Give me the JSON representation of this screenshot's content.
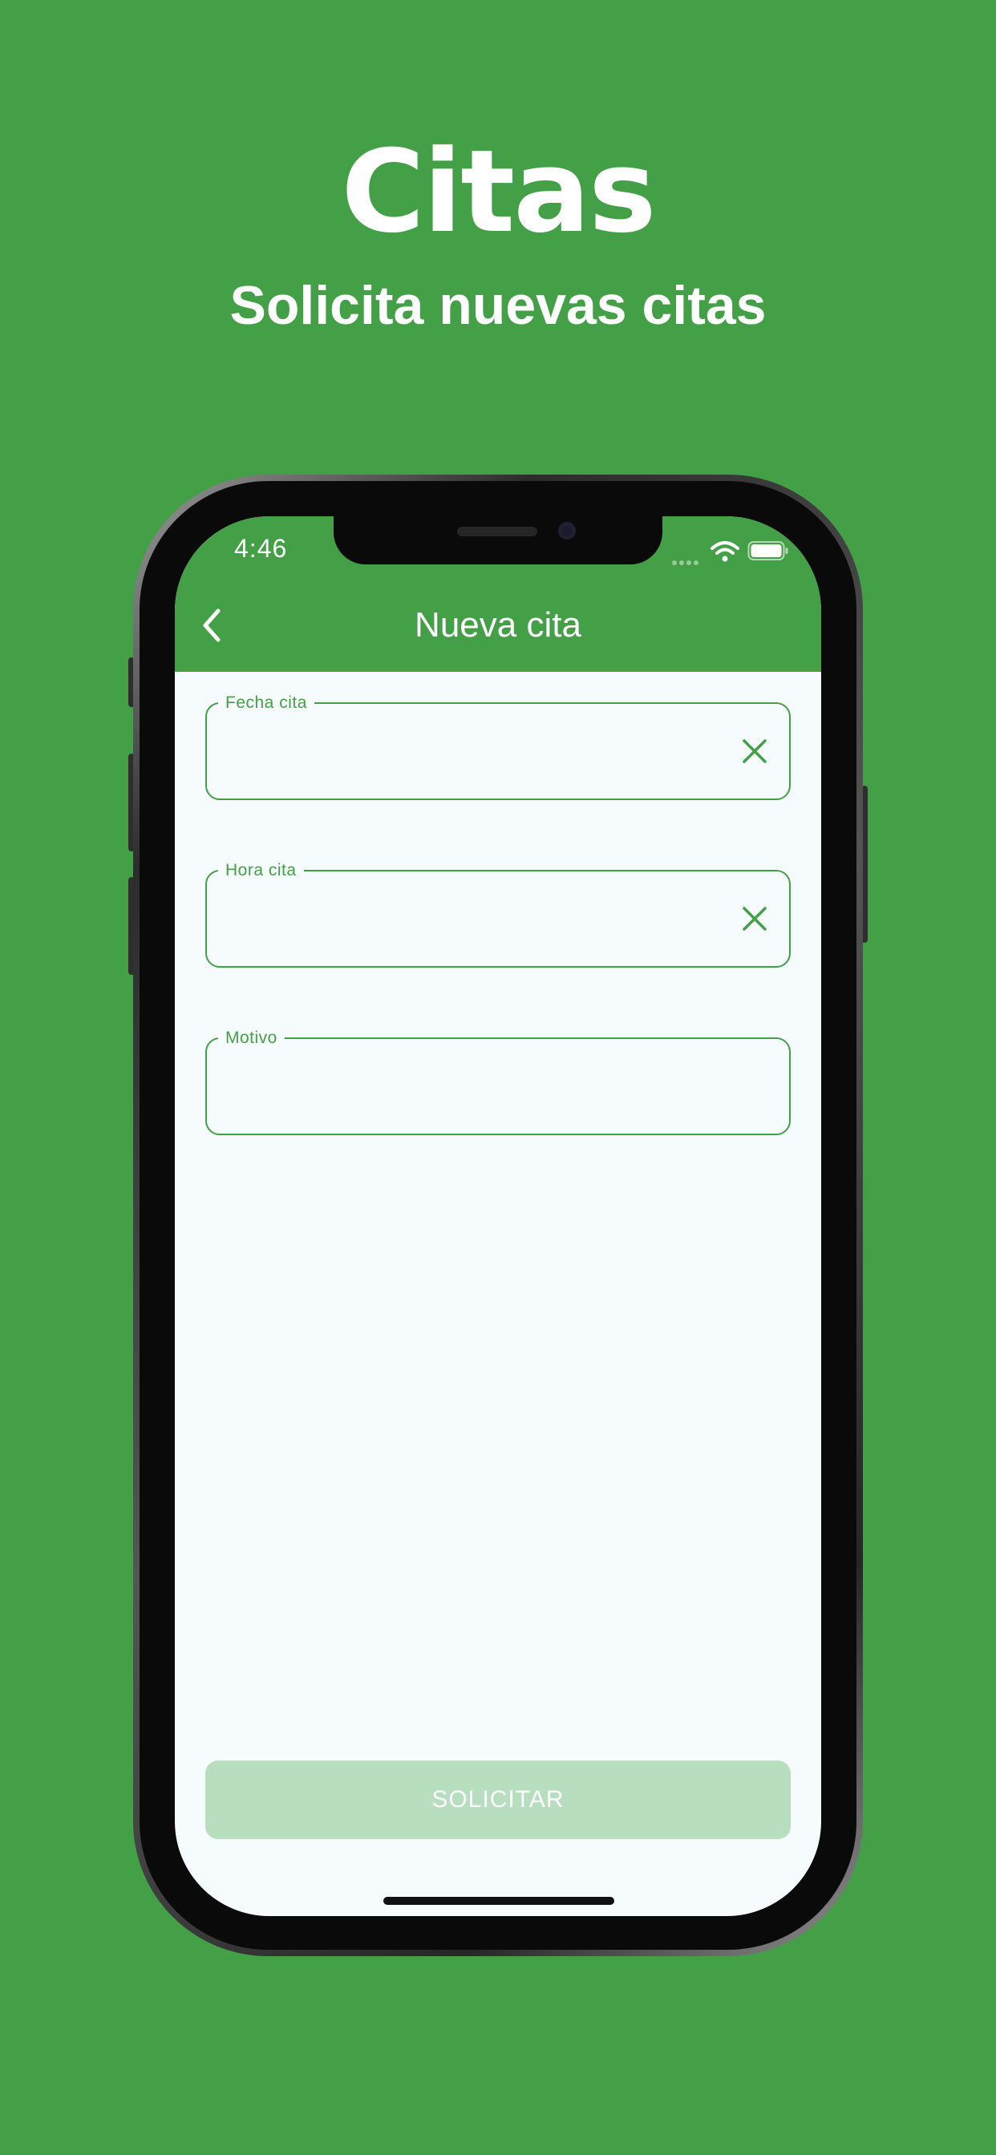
{
  "promo": {
    "title": "Citas",
    "subtitle": "Solicita nuevas citas"
  },
  "status_bar": {
    "time": "4:46",
    "icons": [
      "signal-dots-icon",
      "wifi-icon",
      "battery-icon"
    ]
  },
  "app_bar": {
    "title": "Nueva cita",
    "back_icon": "chevron-left-icon"
  },
  "form": {
    "fields": [
      {
        "label": "Fecha cita",
        "value": "",
        "has_clear": true
      },
      {
        "label": "Hora cita",
        "value": "",
        "has_clear": true
      },
      {
        "label": "Motivo",
        "value": "",
        "has_clear": false
      }
    ],
    "submit_label": "SOLICITAR"
  },
  "colors": {
    "brand_green": "#44a046",
    "screen_background": "#f6fcfd",
    "disabled_button": "#b8dec0"
  }
}
